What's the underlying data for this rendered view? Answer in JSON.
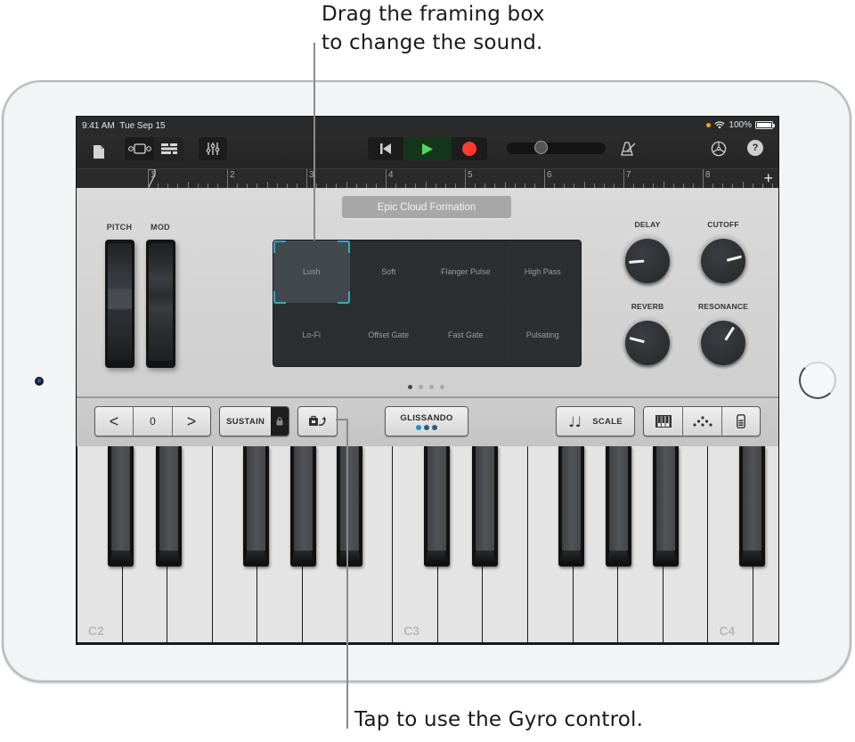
{
  "callouts": {
    "top_line1": "Drag the framing box",
    "top_line2": "to change the sound.",
    "bottom": "Tap to use the Gyro control."
  },
  "status_bar": {
    "time": "9:41 AM",
    "date": "Tue Sep 15",
    "battery": "100%",
    "battery_level": 1.0
  },
  "toolbar": {
    "icons": [
      "my-songs-icon",
      "browser-icon",
      "tracks-view-icon",
      "mixer-icon",
      "go-to-beginning-icon",
      "play-icon",
      "record-icon",
      "master-volume-slider",
      "metronome-icon",
      "settings-icon",
      "help-icon"
    ],
    "help_label": "?",
    "volume_level": 0.32,
    "colors": {
      "play": "#4cd964",
      "play_bg": "#15351b",
      "record": "#ff3b30"
    }
  },
  "ruler": {
    "bars": [
      "1",
      "2",
      "3",
      "4",
      "5",
      "6",
      "7",
      "8"
    ],
    "add_label": "+"
  },
  "panel": {
    "patch_name": "Epic Cloud Formation",
    "wheels": [
      {
        "label": "PITCH"
      },
      {
        "label": "MOD"
      }
    ],
    "sounds": [
      "Lush",
      "Soft",
      "Flanger Pulse",
      "High Pass",
      "Lo-Fi",
      "Offset Gate",
      "Fast Gate",
      "Pulsating"
    ],
    "selected_sound": "Lush",
    "page_count": 4,
    "current_page": 1,
    "knobs": [
      {
        "label": "DELAY",
        "value": 0.15
      },
      {
        "label": "CUTOFF",
        "value": 0.78
      },
      {
        "label": "REVERB",
        "value": 0.22
      },
      {
        "label": "RESONANCE",
        "value": 0.62
      }
    ],
    "frame_color": "#35a6c0"
  },
  "strip": {
    "octave_down": "<",
    "octave_value": "0",
    "octave_up": ">",
    "sustain": "SUSTAIN",
    "glissando": "GLISSANDO",
    "scale": "SCALE",
    "scale_icon": "♩♩",
    "glissando_dot_color": "#2d8fc6",
    "view_icons": [
      "keyboard-layout-icon",
      "arpeggiator-icon",
      "velocity-icon"
    ]
  },
  "keyboard": {
    "labels": {
      "c2": "C2",
      "c3": "C3",
      "c4": "C4"
    }
  }
}
